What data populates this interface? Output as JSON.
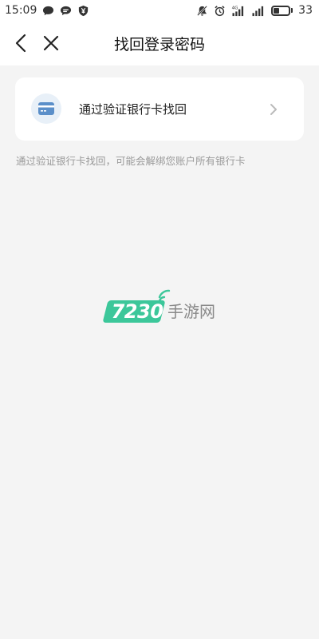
{
  "status_bar": {
    "time": "15:09",
    "battery_level": "33",
    "network_label": "4G"
  },
  "nav": {
    "title": "找回登录密码"
  },
  "option": {
    "label": "通过验证银行卡找回",
    "icon": "bank-card-icon"
  },
  "hint": "通过验证银行卡找回，可能会解绑您账户所有银行卡",
  "watermark": {
    "number": "7230",
    "text": "手游网"
  },
  "colors": {
    "card_icon_bg": "#e8f0f8",
    "card_icon": "#5b8fc9",
    "watermark_green": "#3cc79a",
    "background": "#f4f4f4"
  }
}
